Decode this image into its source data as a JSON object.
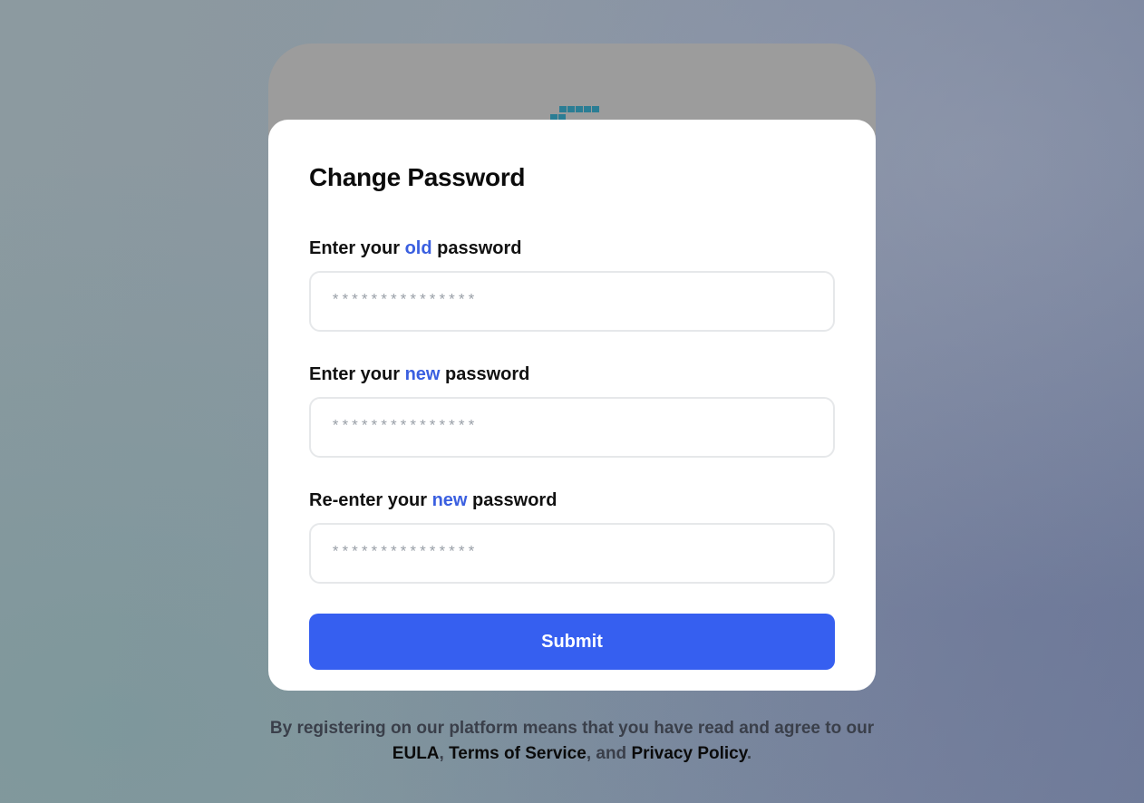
{
  "colors": {
    "accent": "#3a5fe0",
    "button": "#365ff0",
    "logo": "#2b7d94"
  },
  "logo": {
    "icon": "pixel-brand-logo"
  },
  "modal": {
    "title": "Change Password",
    "fields": [
      {
        "label_prefix": "Enter your ",
        "label_accent": "old",
        "label_suffix": " password",
        "placeholder": "***************",
        "value": ""
      },
      {
        "label_prefix": "Enter your ",
        "label_accent": "new",
        "label_suffix": " password",
        "placeholder": "***************",
        "value": ""
      },
      {
        "label_prefix": "Re-enter your ",
        "label_accent": "new",
        "label_suffix": " password",
        "placeholder": "***************",
        "value": ""
      }
    ],
    "submit_label": "Submit"
  },
  "footer": {
    "text_1": "By registering on our platform means that you have read and agree to our ",
    "link_eula": "EULA",
    "sep_1": ", ",
    "link_terms": "Terms of Service",
    "sep_2": ", and ",
    "link_privacy": "Privacy Policy",
    "end": "."
  }
}
